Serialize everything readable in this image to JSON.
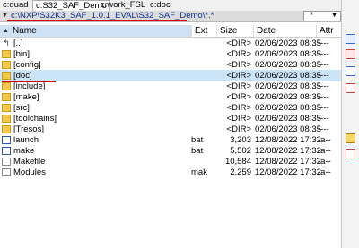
{
  "tabs": [
    {
      "label": "c:quad",
      "active": false
    },
    {
      "label": "c:S32_SAF_Demo",
      "active": true
    },
    {
      "label": "c:work_FSL",
      "active": false
    },
    {
      "label": "c:doc",
      "active": false
    }
  ],
  "path": {
    "text": "c:\\NXP\\S32K3_SAF_1.0.1_EVAL\\S32_SAF_Demo\\*.*"
  },
  "mask": {
    "value": "*"
  },
  "columns": {
    "name": "Name",
    "ext": "Ext",
    "size": "Size",
    "date": "Date",
    "attr": "Attr"
  },
  "rows": [
    {
      "kind": "up",
      "name": "[..]",
      "ext": "",
      "size": "<DIR>",
      "date": "02/06/2023 08:35",
      "attr": "----"
    },
    {
      "kind": "folder",
      "name": "[bin]",
      "ext": "",
      "size": "<DIR>",
      "date": "02/06/2023 08:35",
      "attr": "----"
    },
    {
      "kind": "folder",
      "name": "[config]",
      "ext": "",
      "size": "<DIR>",
      "date": "02/06/2023 08:35",
      "attr": "----"
    },
    {
      "kind": "folder",
      "name": "[doc]",
      "ext": "",
      "size": "<DIR>",
      "date": "02/06/2023 08:35",
      "attr": "----",
      "selected": true
    },
    {
      "kind": "folder",
      "name": "[include]",
      "ext": "",
      "size": "<DIR>",
      "date": "02/06/2023 08:35",
      "attr": "----"
    },
    {
      "kind": "folder",
      "name": "[make]",
      "ext": "",
      "size": "<DIR>",
      "date": "02/06/2023 08:35",
      "attr": "----"
    },
    {
      "kind": "folder",
      "name": "[src]",
      "ext": "",
      "size": "<DIR>",
      "date": "02/06/2023 08:35",
      "attr": "----"
    },
    {
      "kind": "folder",
      "name": "[toolchains]",
      "ext": "",
      "size": "<DIR>",
      "date": "02/06/2023 08:35",
      "attr": "----"
    },
    {
      "kind": "folder",
      "name": "[Tresos]",
      "ext": "",
      "size": "<DIR>",
      "date": "02/06/2023 08:35",
      "attr": "----"
    },
    {
      "kind": "bat",
      "name": "launch",
      "ext": "bat",
      "size": "3,203",
      "date": "12/08/2022 17:32",
      "attr": "-a--"
    },
    {
      "kind": "bat",
      "name": "make",
      "ext": "bat",
      "size": "5,502",
      "date": "12/08/2022 17:32",
      "attr": "-a--"
    },
    {
      "kind": "plain",
      "name": "Makefile",
      "ext": "",
      "size": "10,584",
      "date": "12/08/2022 17:32",
      "attr": "-a--"
    },
    {
      "kind": "plain",
      "name": "Modules",
      "ext": "mak",
      "size": "2,259",
      "date": "12/08/2022 17:32",
      "attr": "-a--"
    }
  ],
  "toolbar": [
    "copy-icon",
    "delete-icon",
    "rename-icon",
    "edit-icon",
    "pack-icon",
    "edit-icon"
  ],
  "colors": {
    "selection": "#cce4f7",
    "folder": "#f2c94c",
    "annotation": "#d40000",
    "path": "#0b2f8f"
  }
}
